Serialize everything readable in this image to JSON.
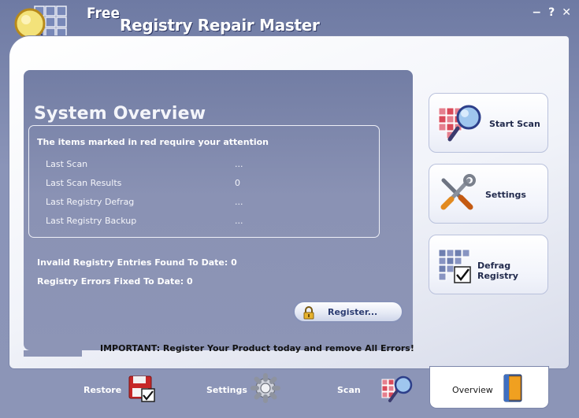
{
  "window": {
    "title_free": "Free",
    "title_main": "Registry Repair Master",
    "btn_minimize": "−",
    "btn_help": "?",
    "btn_close": "✕"
  },
  "overview": {
    "title": "System Overview",
    "note": "The items marked in red require your attention",
    "rows": [
      {
        "label": "Last Scan",
        "value": "..."
      },
      {
        "label": "Last Scan Results",
        "value": "0"
      },
      {
        "label": "Last Registry Defrag",
        "value": "..."
      },
      {
        "label": "Last Registry Backup",
        "value": "..."
      }
    ],
    "stat_invalid": "Invalid Registry Entries Found To Date: 0",
    "stat_fixed": "Registry Errors Fixed To Date: 0",
    "register_label": "Register...",
    "important": "IMPORTANT: Register Your Product today and remove All Errors!"
  },
  "side": {
    "start_scan": "Start Scan",
    "settings": "Settings",
    "defrag": "Defrag Registry"
  },
  "tabs": {
    "restore": "Restore",
    "settings": "Settings",
    "scan": "Scan",
    "overview": "Overview"
  },
  "icons": {
    "logo": "magnifier-grid-icon",
    "start_scan": "magnifier-grid-icon",
    "settings": "tools-icon",
    "defrag": "grid-check-icon",
    "restore": "floppy-check-icon",
    "settings_tab": "gear-icon",
    "scan_tab": "magnifier-grid-icon",
    "overview_tab": "book-icon",
    "register": "lock-icon"
  },
  "colors": {
    "accent": "#8a93b5",
    "panel": "#8d95b6",
    "grid_red": "#d94a5a",
    "grid_blue": "#6f7fb0"
  }
}
